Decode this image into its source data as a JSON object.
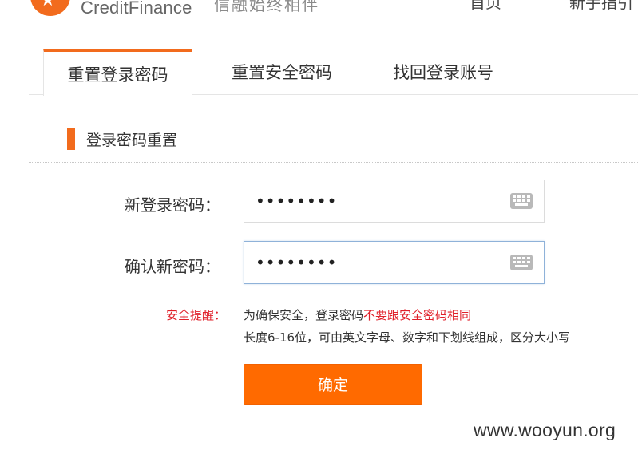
{
  "header": {
    "logo_text": "CreditFinance",
    "slogan": "信融始终相伴",
    "nav": {
      "home": "首页",
      "guide": "新手指引"
    }
  },
  "tabs": [
    {
      "label": "重置登录密码",
      "active": true
    },
    {
      "label": "重置安全密码",
      "active": false
    },
    {
      "label": "找回登录账号",
      "active": false
    }
  ],
  "section": {
    "title": "登录密码重置"
  },
  "form": {
    "new_password": {
      "label": "新登录密码：",
      "value": "••••••••",
      "icon": "keyboard-icon"
    },
    "confirm_password": {
      "label": "确认新密码：",
      "value": "••••••••",
      "icon": "keyboard-icon",
      "focused": true
    }
  },
  "tip": {
    "label": "安全提醒：",
    "line1_prefix": "为确保安全，登录密码",
    "line1_warning": "不要跟安全密码相同",
    "line2": "长度6-16位，可由英文字母、数字和下划线组成，区分大小写"
  },
  "submit": {
    "label": "确定"
  },
  "watermark": "www.wooyun.org",
  "colors": {
    "accent": "#f26b1d",
    "button": "#ff6a00",
    "warning": "#e0202a",
    "focus_border": "#8fb2d9"
  }
}
